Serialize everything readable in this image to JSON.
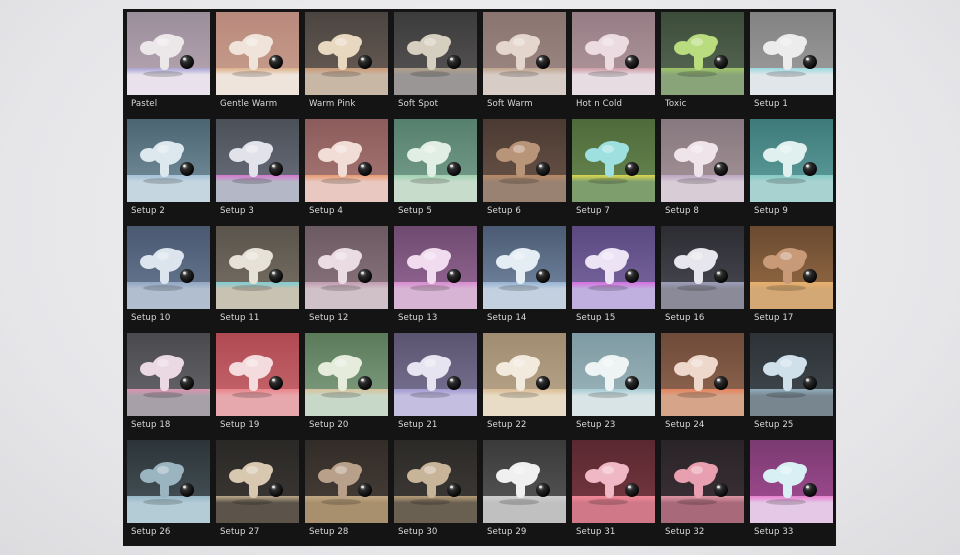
{
  "tiles": [
    {
      "label": "Pastel",
      "bg_top": "#9a8e9a",
      "bg_bot": "#b9a8b4",
      "floor": "#e9e2ec",
      "rim": "#a8a4d8",
      "monkey": "#ece8ea"
    },
    {
      "label": "Gentle Warm",
      "bg_top": "#b8897c",
      "bg_bot": "#caa090",
      "floor": "#efe4dc",
      "rim": "#e0b48a",
      "monkey": "#f0e4da"
    },
    {
      "label": "Warm Pink",
      "bg_top": "#4a4440",
      "bg_bot": "#6e6058",
      "floor": "#c9b7a6",
      "rim": "#d6a27a",
      "monkey": "#e8d8c0"
    },
    {
      "label": "Soft Spot",
      "bg_top": "#3c3c3c",
      "bg_bot": "#5a5656",
      "floor": "#9a9696",
      "rim": "#b8a890",
      "monkey": "#d6cebe"
    },
    {
      "label": "Soft Warm",
      "bg_top": "#8a7470",
      "bg_bot": "#a08a84",
      "floor": "#d8ccc6",
      "rim": "#c4a890",
      "monkey": "#e4d6cc"
    },
    {
      "label": "Hot n Cold",
      "bg_top": "#967c84",
      "bg_bot": "#b49aa0",
      "floor": "#e6dce2",
      "rim": "#d49ca8",
      "monkey": "#ecdce2"
    },
    {
      "label": "Toxic",
      "bg_top": "#3c4c3a",
      "bg_bot": "#5a6c56",
      "floor": "#8aa47a",
      "rim": "#a6d06a",
      "monkey": "#b8dc7e"
    },
    {
      "label": "Setup 1",
      "bg_top": "#828282",
      "bg_bot": "#a0a0a0",
      "floor": "#e0e6ea",
      "rim": "#9ce0e8",
      "monkey": "#ececec"
    },
    {
      "label": "Setup 2",
      "bg_top": "#4a6472",
      "bg_bot": "#7a94a2",
      "floor": "#c6d6e0",
      "rim": "#a8c8e0",
      "monkey": "#dde8ee"
    },
    {
      "label": "Setup 3",
      "bg_top": "#4c5058",
      "bg_bot": "#6c7280",
      "floor": "#b4b8c6",
      "rim": "#e07ad8",
      "monkey": "#e2e2ea"
    },
    {
      "label": "Setup 4",
      "bg_top": "#8c5c5c",
      "bg_bot": "#a87a76",
      "floor": "#e8c8c0",
      "rim": "#f0a070",
      "monkey": "#f2dcd6"
    },
    {
      "label": "Setup 5",
      "bg_top": "#56806e",
      "bg_bot": "#7aa08e",
      "floor": "#c8dccc",
      "rim": "#a6d8b8",
      "monkey": "#e0eee4"
    },
    {
      "label": "Setup 6",
      "bg_top": "#4a3a32",
      "bg_bot": "#6e564a",
      "floor": "#9a8272",
      "rim": "#c0906a",
      "monkey": "#b89478"
    },
    {
      "label": "Setup 7",
      "bg_top": "#4e6a3a",
      "bg_bot": "#6a8a52",
      "floor": "#7e9e6e",
      "rim": "#e8e050",
      "monkey": "#9ee0e0"
    },
    {
      "label": "Setup 8",
      "bg_top": "#86787e",
      "bg_bot": "#a8969c",
      "floor": "#d8ccd6",
      "rim": "#c0a8c8",
      "monkey": "#eee4ea"
    },
    {
      "label": "Setup 9",
      "bg_top": "#3e7a7a",
      "bg_bot": "#62a0a0",
      "floor": "#a8d2d0",
      "rim": "#8cd0cc",
      "monkey": "#e0f0ee"
    },
    {
      "label": "Setup 10",
      "bg_top": "#4a5870",
      "bg_bot": "#6a7c96",
      "floor": "#b0bed0",
      "rim": "#96acc8",
      "monkey": "#dce4ee"
    },
    {
      "label": "Setup 11",
      "bg_top": "#5a544c",
      "bg_bot": "#7a7266",
      "floor": "#c8c2b2",
      "rim": "#80d8e0",
      "monkey": "#e6e2d8"
    },
    {
      "label": "Setup 12",
      "bg_top": "#6c5a62",
      "bg_bot": "#8e7880",
      "floor": "#d0c0c8",
      "rim": "#c8a0b8",
      "monkey": "#eadce2"
    },
    {
      "label": "Setup 13",
      "bg_top": "#6e4a70",
      "bg_bot": "#9a6c98",
      "floor": "#d8b4d4",
      "rim": "#e090d8",
      "monkey": "#f0dcee"
    },
    {
      "label": "Setup 14",
      "bg_top": "#4a5a72",
      "bg_bot": "#7a8ea8",
      "floor": "#c2d0e0",
      "rim": "#9ab8d8",
      "monkey": "#e4ecf4"
    },
    {
      "label": "Setup 15",
      "bg_top": "#5a4880",
      "bg_bot": "#7e6aa4",
      "floor": "#c0b0e0",
      "rim": "#e070e8",
      "monkey": "#ece4f4"
    },
    {
      "label": "Setup 16",
      "bg_top": "#2c2c32",
      "bg_bot": "#4c4c56",
      "floor": "#8a8a98",
      "rim": "#a6a6c6",
      "monkey": "#e6e6ec"
    },
    {
      "label": "Setup 17",
      "bg_top": "#6a4a30",
      "bg_bot": "#9a6e48",
      "floor": "#d4a874",
      "rim": "#f0b870",
      "monkey": "#c89a78"
    },
    {
      "label": "Setup 18",
      "bg_top": "#4a4a4e",
      "bg_bot": "#6a686e",
      "floor": "#a8a0a8",
      "rim": "#e89ab8",
      "monkey": "#ead8e2"
    },
    {
      "label": "Setup 19",
      "bg_top": "#b04a52",
      "bg_bot": "#c86a70",
      "floor": "#e6a8ac",
      "rim": "#f08890",
      "monkey": "#f4dcde"
    },
    {
      "label": "Setup 20",
      "bg_top": "#5a7a5a",
      "bg_bot": "#86a286",
      "floor": "#c8d8c8",
      "rim": "#e0c8a0",
      "monkey": "#e6ecdc"
    },
    {
      "label": "Setup 21",
      "bg_top": "#5a5470",
      "bg_bot": "#7e7898",
      "floor": "#c4bee0",
      "rim": "#a8a0d8",
      "monkey": "#e6e4f0"
    },
    {
      "label": "Setup 22",
      "bg_top": "#a08c70",
      "bg_bot": "#bca88c",
      "floor": "#e8dcc6",
      "rim": "#e0c098",
      "monkey": "#f2eadc"
    },
    {
      "label": "Setup 23",
      "bg_top": "#7e9aa2",
      "bg_bot": "#a0b8be",
      "floor": "#d8e4e6",
      "rim": "#a8d0d8",
      "monkey": "#eef4f4"
    },
    {
      "label": "Setup 24",
      "bg_top": "#6e4a38",
      "bg_bot": "#946a54",
      "floor": "#d6a488",
      "rim": "#f08860",
      "monkey": "#eed8cc"
    },
    {
      "label": "Setup 25",
      "bg_top": "#2c3236",
      "bg_bot": "#444c52",
      "floor": "#788690",
      "rim": "#9ab8c8",
      "monkey": "#cfe0ea"
    },
    {
      "label": "Setup 26",
      "bg_top": "#2c3438",
      "bg_bot": "#4a585e",
      "floor": "#b4ccd6",
      "rim": "#a0c4d4",
      "monkey": "#9ab4c0"
    },
    {
      "label": "Setup 27",
      "bg_top": "#2a2826",
      "bg_bot": "#3e3a36",
      "floor": "#5c544a",
      "rim": "#c8b494",
      "monkey": "#d8c8b0"
    },
    {
      "label": "Setup 28",
      "bg_top": "#322c28",
      "bg_bot": "#4a4038",
      "floor": "#a8906e",
      "rim": "#d0b48c",
      "monkey": "#b8a08a"
    },
    {
      "label": "Setup 30",
      "bg_top": "#2c2a28",
      "bg_bot": "#403c38",
      "floor": "#6a6052",
      "rim": "#c4a880",
      "monkey": "#c8b498"
    },
    {
      "label": "Setup 29",
      "bg_top": "#3a3a3a",
      "bg_bot": "#5a5a5a",
      "floor": "#c0c0c0",
      "rim": "#dcdcdc",
      "monkey": "#f0f0f0"
    },
    {
      "label": "Setup 31",
      "bg_top": "#5a2830",
      "bg_bot": "#7a3a44",
      "floor": "#d07888",
      "rim": "#ff90a0",
      "monkey": "#f0b8c4"
    },
    {
      "label": "Setup 32",
      "bg_top": "#2a2428",
      "bg_bot": "#3e3238",
      "floor": "#a86a7a",
      "rim": "#f0a0b0",
      "monkey": "#e8a0b0"
    },
    {
      "label": "Setup 33",
      "bg_top": "#7a3a70",
      "bg_bot": "#a84e98",
      "floor": "#e4c8e6",
      "rim": "#f088d8",
      "monkey": "#d8f0f4"
    }
  ]
}
